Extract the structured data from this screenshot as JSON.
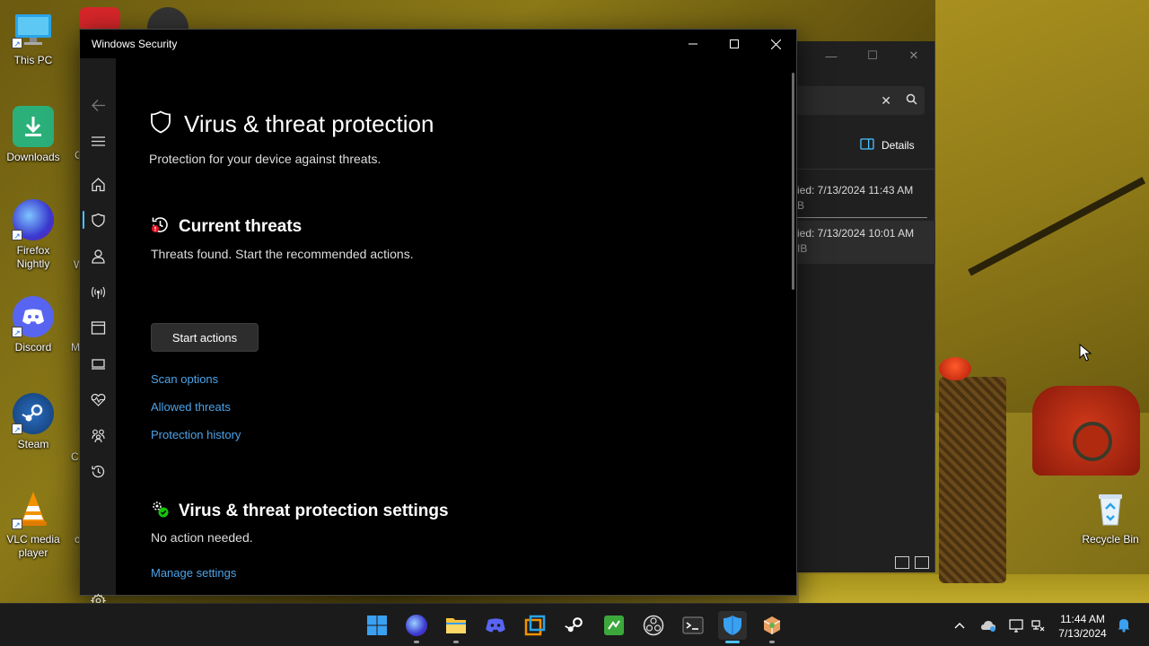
{
  "desktop": {
    "icons": [
      {
        "label": "This PC",
        "icon": "monitor-icon"
      },
      {
        "label": "Downloads",
        "icon": "download-folder-icon"
      },
      {
        "label": "Firefox Nightly",
        "icon": "firefox-nightly-icon"
      },
      {
        "label": "Discord",
        "icon": "discord-icon"
      },
      {
        "label": "Steam",
        "icon": "steam-icon"
      },
      {
        "label": "VLC media player",
        "icon": "vlc-cone-icon"
      }
    ],
    "partial_labels": [
      "C",
      "W",
      "M",
      "C",
      "c"
    ],
    "recycle_bin": {
      "label": "Recycle Bin",
      "icon": "recycle-bin-icon"
    }
  },
  "background_window": {
    "details_label": "Details",
    "rows": [
      {
        "modified": "ied: 7/13/2024 11:43 AM",
        "size": "B"
      },
      {
        "modified": "ied: 7/13/2024 10:01 AM",
        "size": "IB"
      }
    ]
  },
  "security_window": {
    "title": "Windows Security",
    "page_title": "Virus & threat protection",
    "page_subtitle": "Protection for your device against threats.",
    "current_threats": {
      "heading": "Current threats",
      "status": "Threats found. Start the recommended actions.",
      "action_button": "Start actions",
      "links": [
        "Scan options",
        "Allowed threats",
        "Protection history"
      ]
    },
    "settings": {
      "heading": "Virus & threat protection settings",
      "status": "No action needed.",
      "link": "Manage settings"
    },
    "nav_icons": [
      "back-arrow-icon",
      "hamburger-menu-icon",
      "home-icon",
      "shield-icon",
      "person-icon",
      "wireless-antenna-icon",
      "app-browser-icon",
      "laptop-icon",
      "heart-pulse-icon",
      "family-icon",
      "history-icon",
      "settings-gear-icon"
    ]
  },
  "taskbar": {
    "apps": [
      "windows-start-icon",
      "firefox-icon",
      "file-explorer-icon",
      "discord-icon",
      "app-icon",
      "steam-icon",
      "terminal-green-icon",
      "obs-icon",
      "terminal-icon",
      "windows-security-icon",
      "settings-cube-icon"
    ],
    "tray": [
      "chevron-up-icon",
      "cloud-icon",
      "display-icon",
      "network-icon",
      "notification-bell-icon"
    ],
    "time": "11:44 AM",
    "date": "7/13/2024"
  }
}
